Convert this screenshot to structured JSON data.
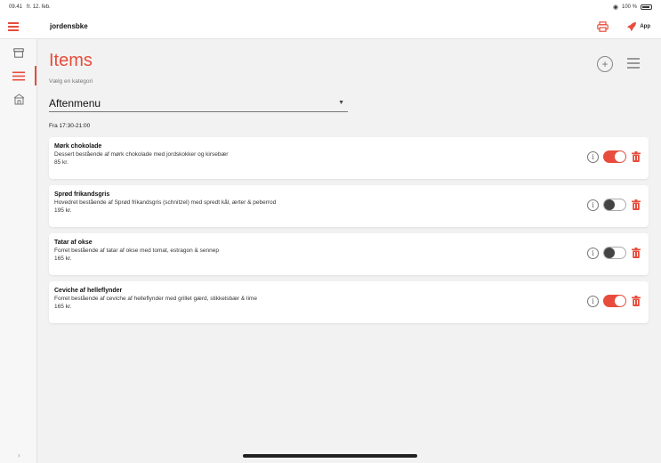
{
  "status": {
    "time": "09.41",
    "date": "fr. 12. feb.",
    "battery": "100 %"
  },
  "header": {
    "restaurant": "jordensbke",
    "app_label": "App"
  },
  "sidebar": {
    "items": [
      {
        "icon": "archive-icon"
      },
      {
        "icon": "list-icon",
        "active": true
      },
      {
        "icon": "shop-icon"
      }
    ]
  },
  "main": {
    "title": "Items",
    "category_label": "Vælg en kategori",
    "category_value": "Aftenmenu",
    "time_range": "Fra 17:30-21:00",
    "items": [
      {
        "name": "Mørk chokolade",
        "description": "Dessert bestående af mørk chokolade med jordskokker og kirsebær",
        "price": "85 kr.",
        "enabled": true
      },
      {
        "name": "Sprød frikandsgris",
        "description": "Hovedret bestående af Sprød frikandsgris (schnitzel) med spredt kål, ærter & peberrod",
        "price": "195 kr.",
        "enabled": false
      },
      {
        "name": "Tatar af okse",
        "description": "Forret bestående af tatar af okse med tomat, estragon & sennep",
        "price": "165 kr.",
        "enabled": false
      },
      {
        "name": "Ceviche af helleflynder",
        "description": "Forret bestående af ceviche af helleflynder med grillet gærd, stikkelsbær & lime",
        "price": "165 kr.",
        "enabled": true
      }
    ]
  },
  "colors": {
    "accent": "#e74c3c"
  }
}
